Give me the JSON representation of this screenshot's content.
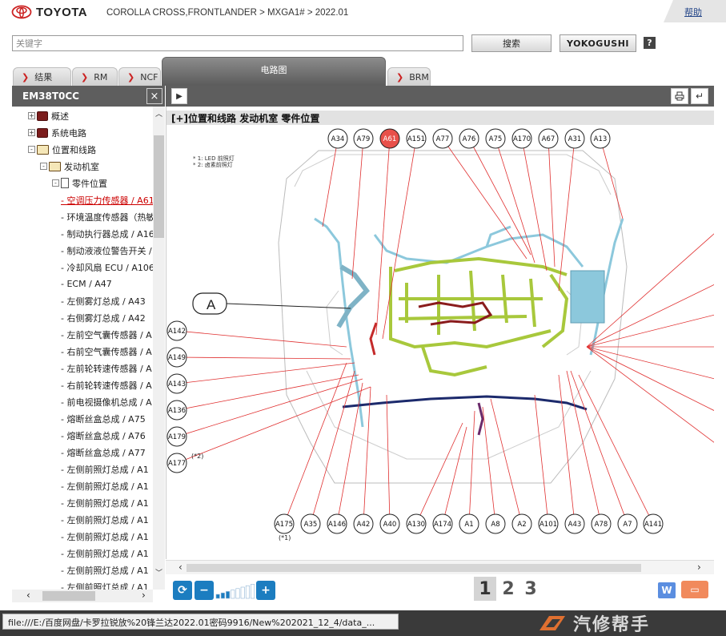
{
  "header": {
    "brand": "TOYOTA",
    "breadcrumb": "COROLLA CROSS,FRONTLANDER > MXGA1# > 2022.01",
    "help": "帮助"
  },
  "search": {
    "placeholder": "关键字",
    "search_button": "搜索",
    "yokogushi_button": "YOKOGUSHI",
    "help_button": "?"
  },
  "tabs": [
    {
      "label": "结果"
    },
    {
      "label": "RM"
    },
    {
      "label": "NCF"
    },
    {
      "label": "电路图",
      "active": true
    },
    {
      "label": "BRM"
    }
  ],
  "left_pane": {
    "title": "EM38T0CC",
    "close": "×",
    "tree": [
      {
        "label": "概述",
        "level": 1,
        "icon": "book-icon",
        "expander": "+"
      },
      {
        "label": "系统电路",
        "level": 1,
        "icon": "book-icon",
        "expander": "+"
      },
      {
        "label": "位置和线路",
        "level": 1,
        "icon": "open-book-icon",
        "expander": "-"
      },
      {
        "label": "发动机室",
        "level": 2,
        "icon": "open-book-icon",
        "expander": "-"
      },
      {
        "label": "零件位置",
        "level": 3,
        "icon": "page-icon",
        "expander": "-"
      },
      {
        "label": "- 空调压力传感器 / A61",
        "level": 4,
        "selected": true
      },
      {
        "label": "- 环境温度传感器（热敏电阻）",
        "level": 4
      },
      {
        "label": "- 制动执行器总成 / A16",
        "level": 4
      },
      {
        "label": "- 制动液液位警告开关 / A",
        "level": 4
      },
      {
        "label": "- 冷却风扇 ECU / A106",
        "level": 4
      },
      {
        "label": "- ECM / A47",
        "level": 4
      },
      {
        "label": "- 左侧雾灯总成 / A43",
        "level": 4
      },
      {
        "label": "- 右侧雾灯总成 / A42",
        "level": 4
      },
      {
        "label": "- 左前空气囊传感器 / A",
        "level": 4
      },
      {
        "label": "- 右前空气囊传感器 / A",
        "level": 4
      },
      {
        "label": "- 左前轮转速传感器 / A",
        "level": 4
      },
      {
        "label": "- 右前轮转速传感器 / A",
        "level": 4
      },
      {
        "label": "- 前电视摄像机总成 / A",
        "level": 4
      },
      {
        "label": "- 熔断丝盒总成 / A75",
        "level": 4
      },
      {
        "label": "- 熔断丝盒总成 / A76",
        "level": 4
      },
      {
        "label": "- 熔断丝盒总成 / A77",
        "level": 4
      },
      {
        "label": "- 左侧前照灯总成 / A1",
        "level": 4
      },
      {
        "label": "- 左侧前照灯总成 / A1",
        "level": 4
      },
      {
        "label": "- 左侧前照灯总成 / A1",
        "level": 4
      },
      {
        "label": "- 左侧前照灯总成 / A1",
        "level": 4
      },
      {
        "label": "- 左侧前照灯总成 / A1",
        "level": 4
      },
      {
        "label": "- 左侧前照灯总成 / A1",
        "level": 4
      },
      {
        "label": "- 左侧前照灯总成 / A1",
        "level": 4
      },
      {
        "label": "- 左侧前照灯总成 / A1",
        "level": 4
      }
    ]
  },
  "diagram": {
    "title": "[+]位置和线路  发动机室  零件位置",
    "notes": [
      "* 1: LED 前照灯",
      "* 2: 卤素前照灯"
    ],
    "callout": "A",
    "top_connectors": [
      "A34",
      "A79",
      "A61",
      "A151",
      "A77",
      "A76",
      "A75",
      "A170",
      "A67",
      "A31",
      "A13"
    ],
    "highlighted": "A61",
    "left_connectors": [
      "A142",
      "A149",
      "A143",
      "A136",
      "A179",
      "A177"
    ],
    "left_note": "(*2)",
    "bottom_connectors": [
      "A175",
      "A35",
      "A146",
      "A42",
      "A40",
      "A130",
      "A174",
      "A1",
      "A8",
      "A2",
      "A101",
      "A43",
      "A78",
      "A7",
      "A141"
    ],
    "bottom_note": "(*1)"
  },
  "toolbar": {
    "pages": [
      "1",
      "2",
      "3"
    ],
    "w_button": "W",
    "zoom_level": 3
  },
  "status": {
    "url": "file:///E:/百度网盘/卡罗拉锐放%20锋兰达2022.01密码9916/New%202021_12_4/data_...",
    "watermark": "汽修帮手"
  },
  "colors": {
    "header_dark": "#5e5e5e",
    "highlight_red": "#e8504a",
    "harness_green": "#a8c83c",
    "harness_blue": "#8cc8dc",
    "harness_navy": "#1c2a6c",
    "harness_maroon": "#8a1c1c",
    "accent_blue": "#1c7dc0"
  }
}
